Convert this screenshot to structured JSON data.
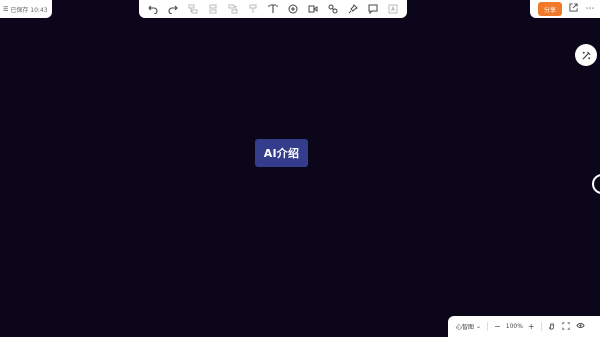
{
  "header": {
    "save_status": "已保存 10:43"
  },
  "toolbar": {
    "icons": [
      "undo-icon",
      "redo-icon",
      "sibling-node-icon",
      "child-node-icon",
      "parent-node-icon",
      "format-painter-icon",
      "text-icon",
      "add-icon",
      "summary-icon",
      "relation-icon",
      "pin-icon",
      "comment-icon",
      "text-box-icon"
    ]
  },
  "actions": {
    "share_label": "分享"
  },
  "canvas": {
    "root_node_label": "AI介绍",
    "background": "#0b0619",
    "node_color": "#333d8c"
  },
  "footer": {
    "layout_label": "心智图",
    "zoom_level": "100%"
  }
}
